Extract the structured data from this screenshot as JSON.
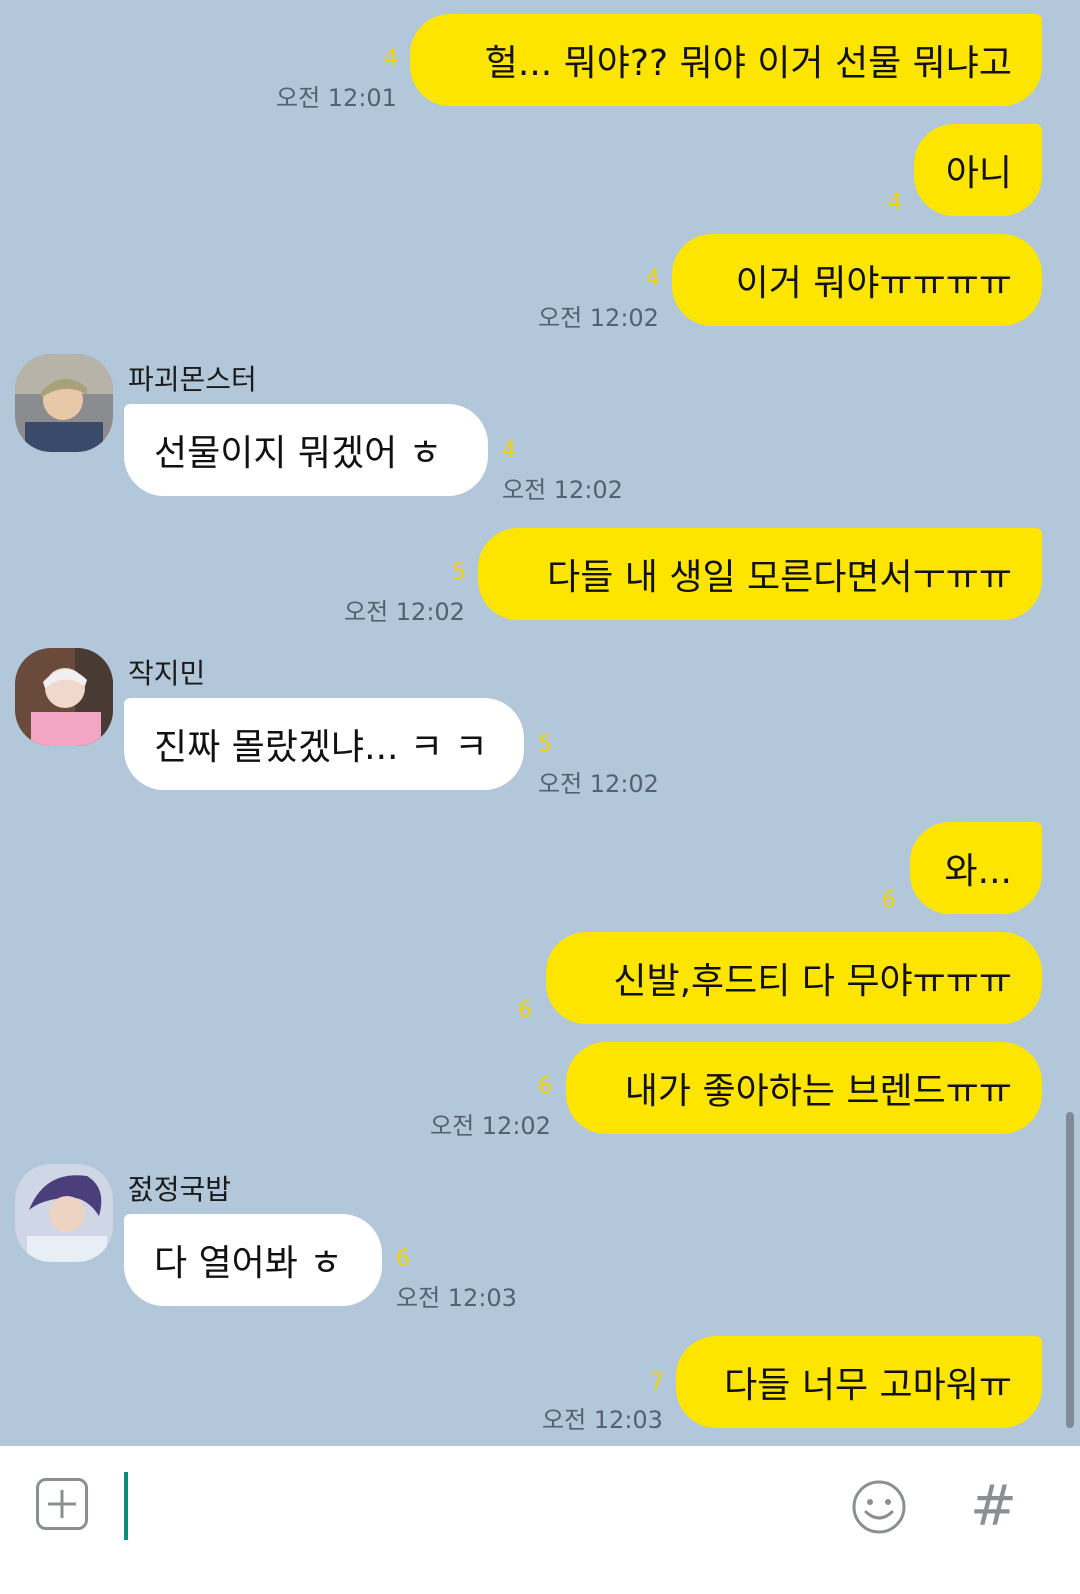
{
  "messages": [
    {
      "text": "헐... 뭐야?? 뭐야 이거 선물 뭐냐고",
      "read": "4",
      "time": "오전 12:01"
    },
    {
      "text": "아니",
      "read": "4"
    },
    {
      "text": "이거 뭐야ㅠㅠㅠㅠ",
      "read": "4",
      "time": "오전 12:02"
    },
    {
      "sender": "파괴몬스터",
      "text": "선물이지 뭐겠어 ㅎ",
      "read": "4",
      "time": "오전 12:02"
    },
    {
      "text": "다들 내 생일 모른다면서ㅜㅠㅠ",
      "read": "5",
      "time": "오전 12:02"
    },
    {
      "sender": "작지민",
      "text": "진짜 몰랐겠냐... ㅋ ㅋ",
      "read": "5",
      "time": "오전 12:02"
    },
    {
      "text": "와...",
      "read": "6"
    },
    {
      "text": "신발,후드티 다 무야ㅠㅠㅠ",
      "read": "6"
    },
    {
      "text": "내가 좋아하는 브렌드ㅠㅠ",
      "read": "6",
      "time": "오전 12:02"
    },
    {
      "sender": "젌정국밥",
      "text": "다 열어봐 ㅎ",
      "read": "6",
      "time": "오전 12:03"
    },
    {
      "text": "다들 너무 고마워ㅠ",
      "read": "7",
      "time": "오전 12:03"
    }
  ],
  "input": {
    "hash_label": "#"
  },
  "colors": {
    "background": "#b2c7d9",
    "my_bubble": "#fee500",
    "their_bubble": "#ffffff",
    "read_count": "#f2d300"
  }
}
